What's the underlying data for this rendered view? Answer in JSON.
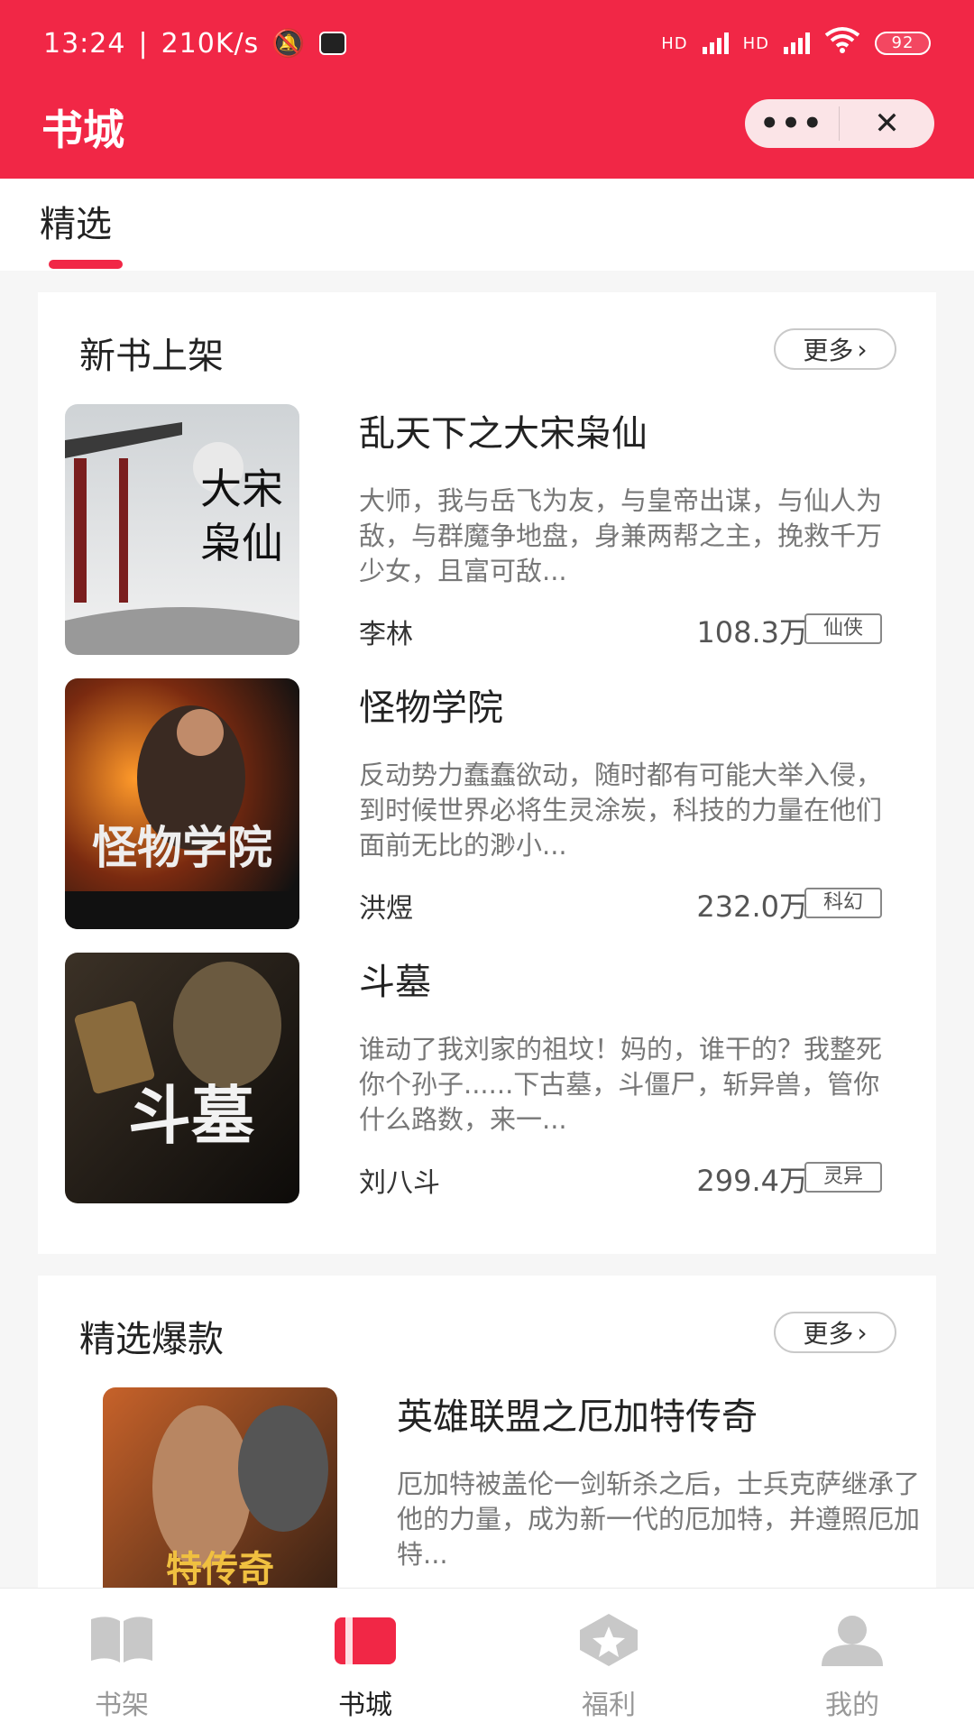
{
  "status_bar": {
    "time": "13:24",
    "network_speed": "210K/s",
    "signal_labels": [
      "HD",
      "HD"
    ],
    "battery": "92"
  },
  "header": {
    "title": "书城",
    "menu_icon": "more-dots-icon",
    "close_icon": "close-icon"
  },
  "tabs": {
    "selected": "精选"
  },
  "new_books": {
    "title": "新书上架",
    "more_label": "更多",
    "books": [
      {
        "title": "乱天下之大宋枭仙",
        "desc": "大师，我与岳飞为友，与皇帝出谋，与仙人为敌，与群魔争地盘，身兼两帮之主，挽救千万少女，且富可敌...",
        "author": "李林",
        "count": "108.3万",
        "tag": "仙侠",
        "cover_text": "大宋枭仙"
      },
      {
        "title": "怪物学院",
        "desc": "反动势力蠢蠢欲动，随时都有可能大举入侵，到时候世界必将生灵涂炭，科技的力量在他们面前无比的渺小...",
        "author": "洪煜",
        "count": "232.0万",
        "tag": "科幻",
        "cover_text": "怪物学院"
      },
      {
        "title": "斗墓",
        "desc": "谁动了我刘家的祖坟！妈的，谁干的？我整死你个孙子......下古墓，斗僵尸，斩异兽，管你什么路数，来一...",
        "author": "刘八斗",
        "count": "299.4万",
        "tag": "灵异",
        "cover_text": "斗墓"
      }
    ]
  },
  "hot_books": {
    "title": "精选爆款",
    "more_label": "更多",
    "books": [
      {
        "title": "英雄联盟之厄加特传奇",
        "desc": "厄加特被盖伦一剑斩杀之后，士兵克萨继承了他的力量，成为新一代的厄加特，并遵照厄加特..."
      }
    ]
  },
  "bottom_nav": [
    {
      "label": "书架",
      "icon": "bookshelf-icon",
      "active": false
    },
    {
      "label": "书城",
      "icon": "bookstore-icon",
      "active": true
    },
    {
      "label": "福利",
      "icon": "welfare-star-icon",
      "active": false
    },
    {
      "label": "我的",
      "icon": "profile-icon",
      "active": false
    }
  ],
  "colors": {
    "brand": "#f12746",
    "capsule_bg": "#fbe4e7",
    "inactive_icon": "#c8c8c8"
  }
}
